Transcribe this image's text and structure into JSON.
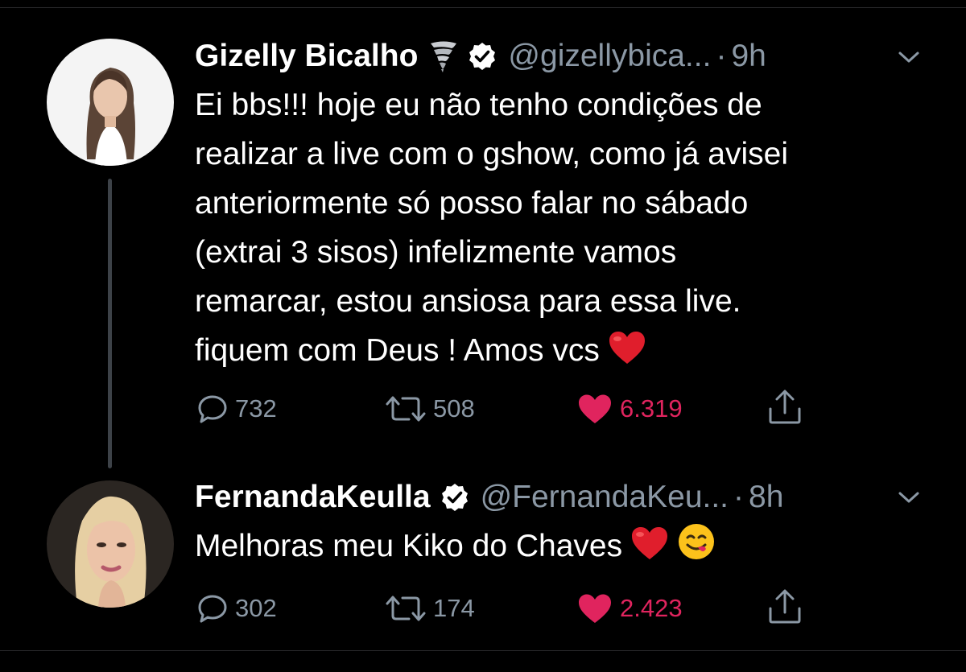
{
  "tweets": [
    {
      "display_name": "Gizelly Bicalho",
      "name_emoji": "tornado-emoji",
      "verified": true,
      "handle": "@gizellybica...",
      "separator": "·",
      "time": "9h",
      "text_lines": [
        "Ei bbs!!! hoje eu não tenho condições de",
        "realizar a live com o gshow, como já avisei",
        "anteriormente só posso falar no sábado",
        "(extrai 3 sisos) infelizmente vamos",
        "remarcar, estou ansiosa para essa live.",
        "fiquem com Deus ! Amos vcs"
      ],
      "text_emojis": [
        "red-heart-emoji"
      ],
      "replies": "732",
      "retweets": "508",
      "likes": "6.319",
      "liked": true
    },
    {
      "display_name": "FernandaKeulla",
      "verified": true,
      "handle": "@FernandaKeu...",
      "separator": "·",
      "time": "8h",
      "text_lines": [
        "Melhoras meu Kiko do Chaves"
      ],
      "text_emojis": [
        "red-heart-emoji",
        "face-savoring-food-emoji"
      ],
      "replies": "302",
      "retweets": "174",
      "likes": "2.423",
      "liked": true
    }
  ],
  "colors": {
    "background": "#000000",
    "secondary_text": "#8b98a5",
    "like_active": "#e0245e",
    "thread_line": "#3d4248"
  }
}
